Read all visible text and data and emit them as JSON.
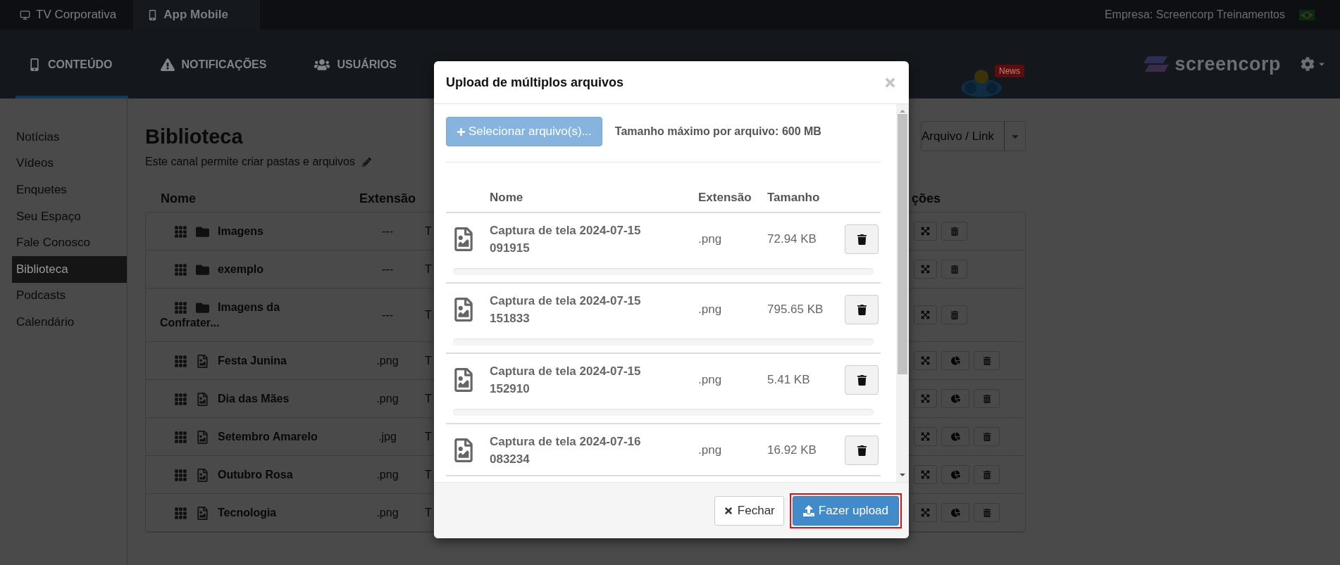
{
  "top_bar": {
    "tabs": [
      {
        "label": "TV Corporativa",
        "kind": "tv",
        "selected": false
      },
      {
        "label": "App Mobile",
        "kind": "mobile",
        "selected": true
      }
    ],
    "company": "Empresa: Screencorp Treinamentos"
  },
  "nav": {
    "items": [
      {
        "label": "CONTEÚDO",
        "kind": "mobile",
        "selected": true
      },
      {
        "label": "NOTIFICAÇÕES",
        "kind": "warning",
        "selected": false
      },
      {
        "label": "USUÁRIOS",
        "kind": "users",
        "selected": false
      }
    ],
    "news_badge": "News",
    "logo": "screencorp"
  },
  "sidebar": {
    "items": [
      {
        "label": "Notícias",
        "selected": false
      },
      {
        "label": "Vídeos",
        "selected": false
      },
      {
        "label": "Enquetes",
        "selected": false
      },
      {
        "label": "Seu Espaço",
        "selected": false
      },
      {
        "label": "Fale Conosco",
        "selected": false
      },
      {
        "label": "Biblioteca",
        "selected": true
      },
      {
        "label": "Podcasts",
        "selected": false
      },
      {
        "label": "Calendário",
        "selected": false
      }
    ]
  },
  "library": {
    "title": "Biblioteca",
    "subtitle": "Este canal permite criar pastas e arquivos",
    "add_button": "Arquivo / Link",
    "columns": [
      "Nome",
      "Extensão"
    ],
    "actions_column": "ções",
    "rows": [
      {
        "kind": "folder",
        "name": "Imagens",
        "extension": "---",
        "column_3": "T"
      },
      {
        "kind": "folder",
        "name": "exemplo",
        "extension": "---",
        "column_3": "T"
      },
      {
        "kind": "folder",
        "name": "Imagens da Confrater...",
        "extension": "---",
        "column_3": "T"
      },
      {
        "kind": "file",
        "name": "Festa Junina",
        "extension": ".png",
        "column_3": "T"
      },
      {
        "kind": "file",
        "name": "Dia das Mães",
        "extension": ".png",
        "column_3": "T"
      },
      {
        "kind": "file",
        "name": "Setembro Amarelo",
        "extension": ".jpg",
        "column_3": "T"
      },
      {
        "kind": "file",
        "name": "Outubro Rosa",
        "extension": ".png",
        "column_3": "T"
      },
      {
        "kind": "file",
        "name": "Tecnologia",
        "extension": ".png",
        "column_3": "T"
      }
    ]
  },
  "modal": {
    "title": "Upload de múltiplos arquivos",
    "select_button": "Selecionar arquivo(s)...",
    "max_size": "Tamanho máximo por arquivo: 600 MB",
    "columns": [
      "Nome",
      "Extensão",
      "Tamanho"
    ],
    "files": [
      {
        "name": "Captura de tela 2024-07-15 091915",
        "extension": ".png",
        "size": "72.94 KB",
        "level": 0
      },
      {
        "name": "Captura de tela 2024-07-15 151833",
        "extension": ".png",
        "size": "795.65 KB",
        "level": 0
      },
      {
        "name": "Captura de tela 2024-07-15 152910",
        "extension": ".png",
        "size": "5.41 KB",
        "level": 0
      },
      {
        "name": "Captura de tela 2024-07-16 083234",
        "extension": ".png",
        "size": "16.92 KB"
      }
    ],
    "close_button": "Fechar",
    "upload_button": {
      "label": "Fazer upload",
      "highlighted": true
    }
  }
}
